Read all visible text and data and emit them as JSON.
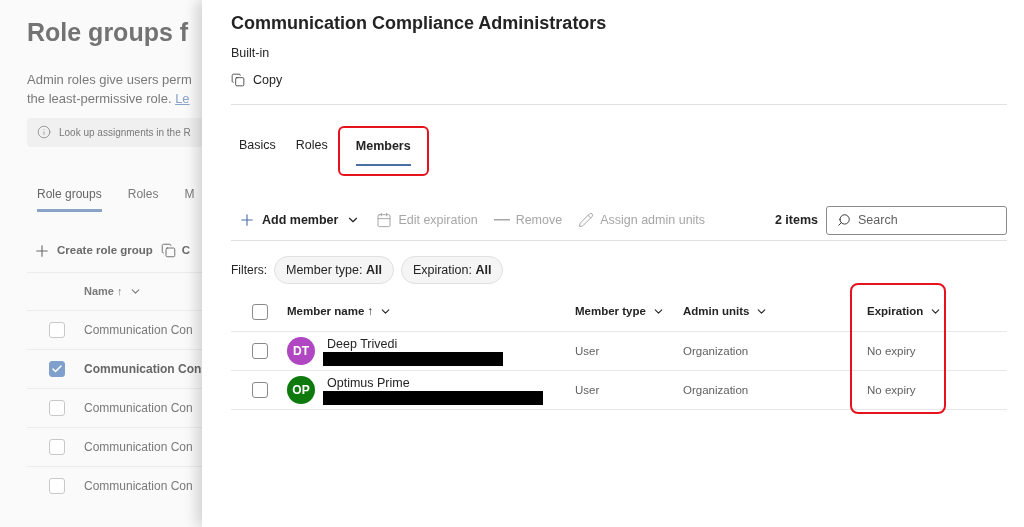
{
  "background_page": {
    "title": "Role groups f",
    "description_lines": [
      "Admin roles give users perm",
      "the least-permissive role."
    ],
    "description_link": "Le",
    "info": "Look up assignments in the R",
    "tabs": [
      {
        "label": "Role groups",
        "selected": true
      },
      {
        "label": "Roles",
        "selected": false
      },
      {
        "label": "M",
        "selected": false
      }
    ],
    "toolbar": [
      {
        "label": "Create role group",
        "kind": "add"
      },
      {
        "label": "C",
        "kind": "copy"
      }
    ],
    "column": "Name ↑",
    "rows": [
      {
        "name": "Communication Con",
        "checked": false
      },
      {
        "name": "Communication Con",
        "checked": true
      },
      {
        "name": "Communication Con",
        "checked": false
      },
      {
        "name": "Communication Con",
        "checked": false
      },
      {
        "name": "Communication Con",
        "checked": false
      }
    ]
  },
  "panel": {
    "title": "Communication Compliance Administrators",
    "subtitle": "Built-in",
    "copy": "Copy",
    "tabs": [
      {
        "label": "Basics",
        "selected": false,
        "highlighted": false
      },
      {
        "label": "Roles",
        "selected": false,
        "highlighted": false
      },
      {
        "label": "Members",
        "selected": true,
        "highlighted": true
      }
    ],
    "toolbar": [
      {
        "label": "Add member",
        "kind": "add",
        "disabled": false
      },
      {
        "label": "Edit expiration",
        "kind": "calendar",
        "disabled": true
      },
      {
        "label": "Remove",
        "kind": "remove",
        "disabled": true
      },
      {
        "label": "Assign admin units",
        "kind": "edit",
        "disabled": true
      }
    ],
    "item_count": "2 items",
    "search": {
      "placeholder": "Search"
    },
    "filters_label": "Filters:",
    "filters": [
      {
        "name": "Member type:",
        "value": "All"
      },
      {
        "name": "Expiration:",
        "value": "All"
      }
    ],
    "select_all_checked": false,
    "columns": [
      {
        "label": "Member name ↑",
        "highlighted": false
      },
      {
        "label": "Member type",
        "highlighted": false
      },
      {
        "label": "Admin units",
        "highlighted": false
      },
      {
        "label": "Expiration",
        "highlighted": true
      }
    ],
    "members": [
      {
        "initials": "DT",
        "name": "Deep Trivedi",
        "color": "#b146c2",
        "redacted": true,
        "checked": false,
        "type": "User",
        "admin_units": "Organization",
        "expiration": "No expiry"
      },
      {
        "initials": "OP",
        "name": "Optimus Prime",
        "color": "#0e7a0d",
        "redacted": true,
        "checked": false,
        "type": "User",
        "admin_units": "Organization",
        "expiration": "No expiry"
      }
    ]
  }
}
